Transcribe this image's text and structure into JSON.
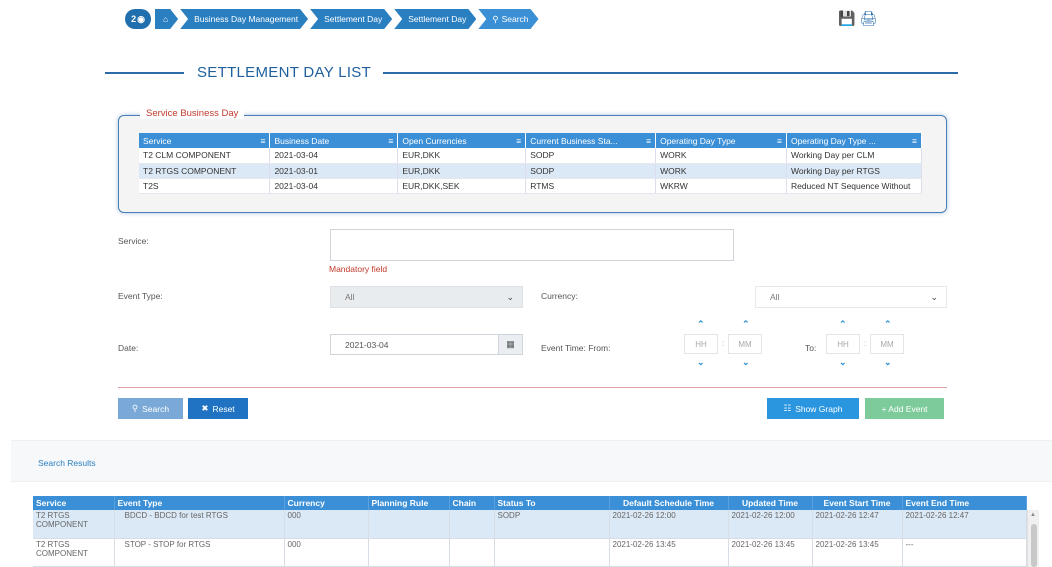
{
  "breadcrumb": {
    "counter": "2",
    "items": [
      "Business Day Management",
      "Settlement Day",
      "Settlement Day",
      "Search"
    ]
  },
  "icons": {
    "home": "home-icon",
    "eye": "eye-icon",
    "save": "save-icon",
    "print": "print-icon",
    "search": "search-icon"
  },
  "page_title": "SETTLEMENT DAY LIST",
  "service_business_day": {
    "legend": "Service Business Day",
    "columns": [
      "Service",
      "Business Date",
      "Open Currencies",
      "Current Business Sta...",
      "Operating Day Type",
      "Operating Day Type ..."
    ],
    "rows": [
      [
        "T2 CLM COMPONENT",
        "2021-03-04",
        "EUR,DKK",
        "SODP",
        "WORK",
        "Working Day per CLM"
      ],
      [
        "T2 RTGS COMPONENT",
        "2021-03-01",
        "EUR,DKK",
        "SODP",
        "WORK",
        "Working Day per RTGS"
      ],
      [
        "T2S",
        "2021-03-04",
        "EUR,DKK,SEK",
        "RTMS",
        "WKRW",
        "Reduced NT Sequence Without"
      ]
    ]
  },
  "form": {
    "service_label": "Service:",
    "service_value": "",
    "mandatory": "Mandatory field",
    "event_type_label": "Event Type:",
    "event_type_value": "All",
    "currency_label": "Currency:",
    "currency_value": "All",
    "date_label": "Date:",
    "date_value": "2021-03-04",
    "event_time_from_label": "Event Time: From:",
    "to_label": "To:",
    "hh_placeholder": "HH",
    "mm_placeholder": "MM"
  },
  "buttons": {
    "search": "Search",
    "reset": "Reset",
    "show_graph": "Show Graph",
    "add_event": "+ Add Event"
  },
  "results": {
    "label": "Search Results",
    "columns": [
      "Service",
      "Event Type",
      "Currency",
      "Planning Rule",
      "Chain",
      "Status To",
      "Default Schedule Time",
      "Updated Time",
      "Event Start Time",
      "Event End Time"
    ],
    "rows": [
      [
        "T2 RTGS COMPONENT",
        "BDCD - BDCD for test RTGS",
        "000",
        "",
        "",
        "SODP",
        "2021-02-26 12:00",
        "2021-02-26 12:00",
        "2021-02-26 12:47",
        "2021-02-26 12:47"
      ],
      [
        "T2 RTGS COMPONENT",
        "STOP - STOP for RTGS",
        "000",
        "",
        "",
        "",
        "2021-02-26 13:45",
        "2021-02-26 13:45",
        "2021-02-26 13:45",
        "---"
      ]
    ]
  }
}
